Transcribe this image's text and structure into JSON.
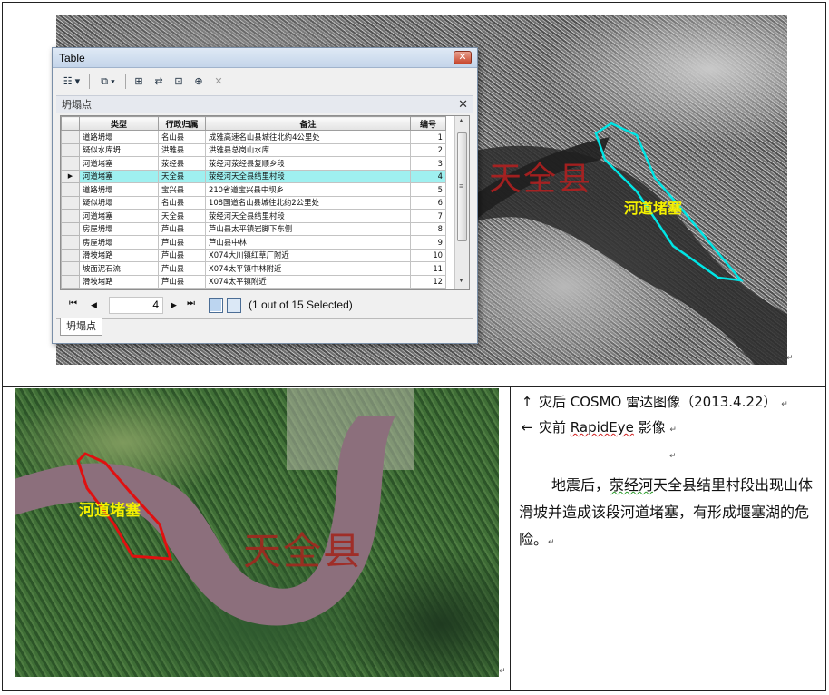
{
  "top_image": {
    "county_label": "天全县",
    "blockage_label": "河道堵塞",
    "outline_color": "#00e5e5"
  },
  "table_window": {
    "title": "Table",
    "close_glyph": "✕",
    "toolbar": {
      "table_options": "☷ ▾",
      "related_tables": "⧉ ▾",
      "select_by_attributes": "⊞",
      "switch_selection": "⇄",
      "clear_selection": "⊡",
      "zoom_to_selected": "⊕",
      "delete_selected": "✕"
    },
    "layer_name": "坍塌点",
    "layer_close": "✕",
    "columns": [
      "类型",
      "行政归属",
      "备注",
      "编号"
    ],
    "rows": [
      [
        "道路坍塌",
        "名山县",
        "成雅高速名山县城往北约4公里处",
        "1"
      ],
      [
        "疑似水库坍",
        "洪雅县",
        "洪雅县总岗山水库",
        "2"
      ],
      [
        "河道堵塞",
        "荥经县",
        "荥经河荥经县复顺乡段",
        "3"
      ],
      [
        "河道堵塞",
        "天全县",
        "荥经河天全县结里村段",
        "4"
      ],
      [
        "道路坍塌",
        "宝兴县",
        "210省道宝兴县中坝乡",
        "5"
      ],
      [
        "疑似坍塌",
        "名山县",
        "108国道名山县城往北约2公里处",
        "6"
      ],
      [
        "河道堵塞",
        "天全县",
        "荥经河天全县结里村段",
        "7"
      ],
      [
        "房屋坍塌",
        "芦山县",
        "芦山县太平镇岩脚下东侧",
        "8"
      ],
      [
        "房屋坍塌",
        "芦山县",
        "芦山县中林",
        "9"
      ],
      [
        "滑坡堵路",
        "芦山县",
        "X074大川镇红草厂附近",
        "10"
      ],
      [
        "坡面泥石流",
        "芦山县",
        "X074太平镇中林附近",
        "11"
      ],
      [
        "滑坡堵路",
        "芦山县",
        "X074太平镇附近",
        "12"
      ]
    ],
    "selected_row_index": 3,
    "nav": {
      "first": "⏮",
      "prev": "◀",
      "record": "4",
      "next": "▶",
      "last": "⏭",
      "status": "(1 out of 15 Selected)"
    },
    "tab_label": "坍塌点"
  },
  "bottom_image": {
    "county_label": "天全县",
    "blockage_label": "河道堵塞",
    "outline_color": "#e01010"
  },
  "notes": {
    "line1_arrow": "↑",
    "line1": "灾后 COSMO 雷达图像（2013.4.22）",
    "line2_arrow": "←",
    "line2_prefix": "灾前 ",
    "line2_brand": "RapidEye",
    "line2_suffix": " 影像",
    "paragraph_a": "地震后，",
    "paragraph_b": "荥经河",
    "paragraph_c": "天全县结里村段出现山体滑坡并造成该段河道堵塞，有形成堰塞湖的危险。"
  },
  "paragraph_mark": "↵"
}
